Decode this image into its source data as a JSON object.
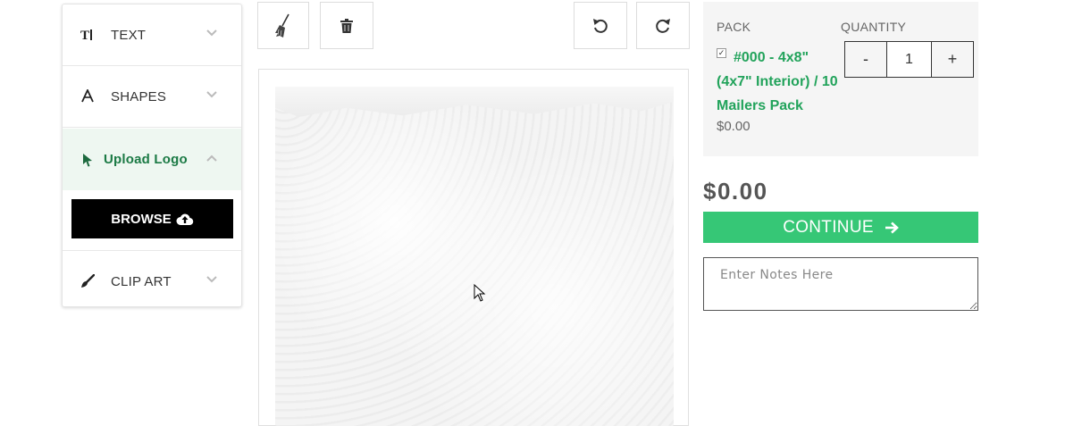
{
  "sidebar": {
    "items": [
      {
        "label": "TEXT",
        "icon": "text-format-icon"
      },
      {
        "label": "SHAPES",
        "icon": "shapes-letter-icon"
      },
      {
        "label": "Upload Logo",
        "icon": "pointer-icon",
        "expanded": true
      },
      {
        "label": "CLIP ART",
        "icon": "brush-icon"
      }
    ],
    "browse_label": "BROWSE"
  },
  "toolbar": {
    "clear_icon": "broom-icon",
    "delete_icon": "trash-icon",
    "undo_icon": "undo-icon",
    "redo_icon": "redo-icon"
  },
  "order": {
    "pack_header": "PACK",
    "quantity_header": "QUANTITY",
    "pack_name": "#000 - 4x8\" (4x7\" Interior) / 10 Mailers Pack",
    "pack_checked": true,
    "pack_price": "$0.00",
    "qty_minus": "-",
    "qty_value": "1",
    "qty_plus": "+",
    "total": "$0.00",
    "continue_label": "CONTINUE",
    "notes_placeholder": "Enter Notes Here"
  },
  "colors": {
    "accent_green": "#36c776",
    "link_green": "#22a35b",
    "browse_bg": "#000000"
  }
}
